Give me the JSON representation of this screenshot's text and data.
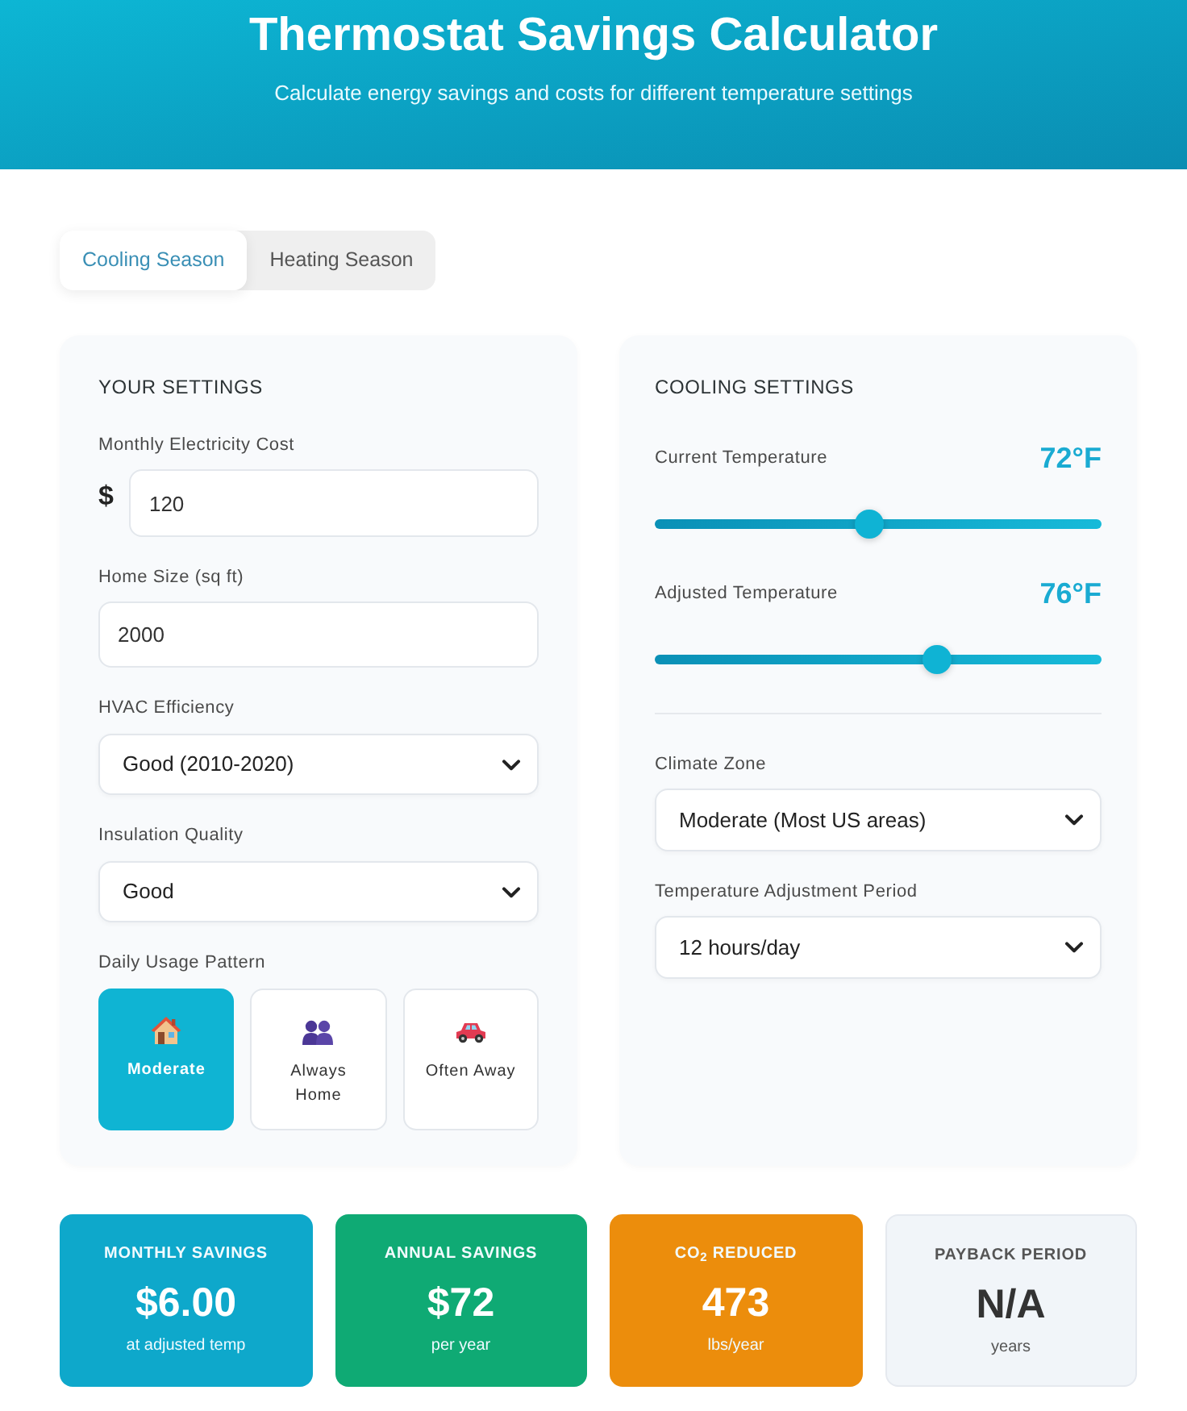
{
  "header": {
    "title": "Thermostat Savings Calculator",
    "subtitle": "Calculate energy savings and costs for different temperature settings"
  },
  "tabs": [
    {
      "label": "Cooling Season",
      "selected": true
    },
    {
      "label": "Heating Season",
      "selected": false
    }
  ],
  "your_settings": {
    "title": "YOUR SETTINGS",
    "fields": [
      {
        "kind": "currency",
        "label": "Monthly Electricity Cost",
        "prefix": "$",
        "value": "120"
      },
      {
        "kind": "text",
        "label": "Home Size (sq ft)",
        "value": "2000"
      },
      {
        "kind": "select",
        "label": "HVAC Efficiency",
        "value": "Good (2010-2020)"
      },
      {
        "kind": "select",
        "label": "Insulation Quality",
        "value": "Good"
      }
    ],
    "usage_pattern": {
      "label": "Daily Usage Pattern",
      "options": [
        {
          "label": "Moderate",
          "selected": true
        },
        {
          "label": "Always Home",
          "selected": false
        },
        {
          "label": "Often Away",
          "selected": false
        }
      ]
    }
  },
  "cooling_settings": {
    "title": "COOLING SETTINGS",
    "sliders": [
      {
        "label": "Current Temperature",
        "reading": "72°F",
        "level": 0.48
      },
      {
        "label": "Adjusted Temperature",
        "reading": "76°F",
        "level": 0.64
      }
    ],
    "fields": [
      {
        "label": "Climate Zone",
        "value": "Moderate (Most US areas)"
      },
      {
        "label": "Temperature Adjustment Period",
        "value": "12 hours/day"
      }
    ]
  },
  "results": [
    {
      "title": "MONTHLY SAVINGS",
      "value": "$6.00",
      "note": "at adjusted temp",
      "color": "#0ea8cb"
    },
    {
      "title": "ANNUAL SAVINGS",
      "value": "$72",
      "note": "per year",
      "color": "#0faa74"
    },
    {
      "title": "CO$_{2}$ REDUCED",
      "value": "473",
      "note": "lbs/year",
      "color": "#ec8d0c"
    },
    {
      "title": "PAYBACK PERIOD",
      "value": "N/A",
      "note": "years",
      "color": "#f1f5f9"
    }
  ]
}
